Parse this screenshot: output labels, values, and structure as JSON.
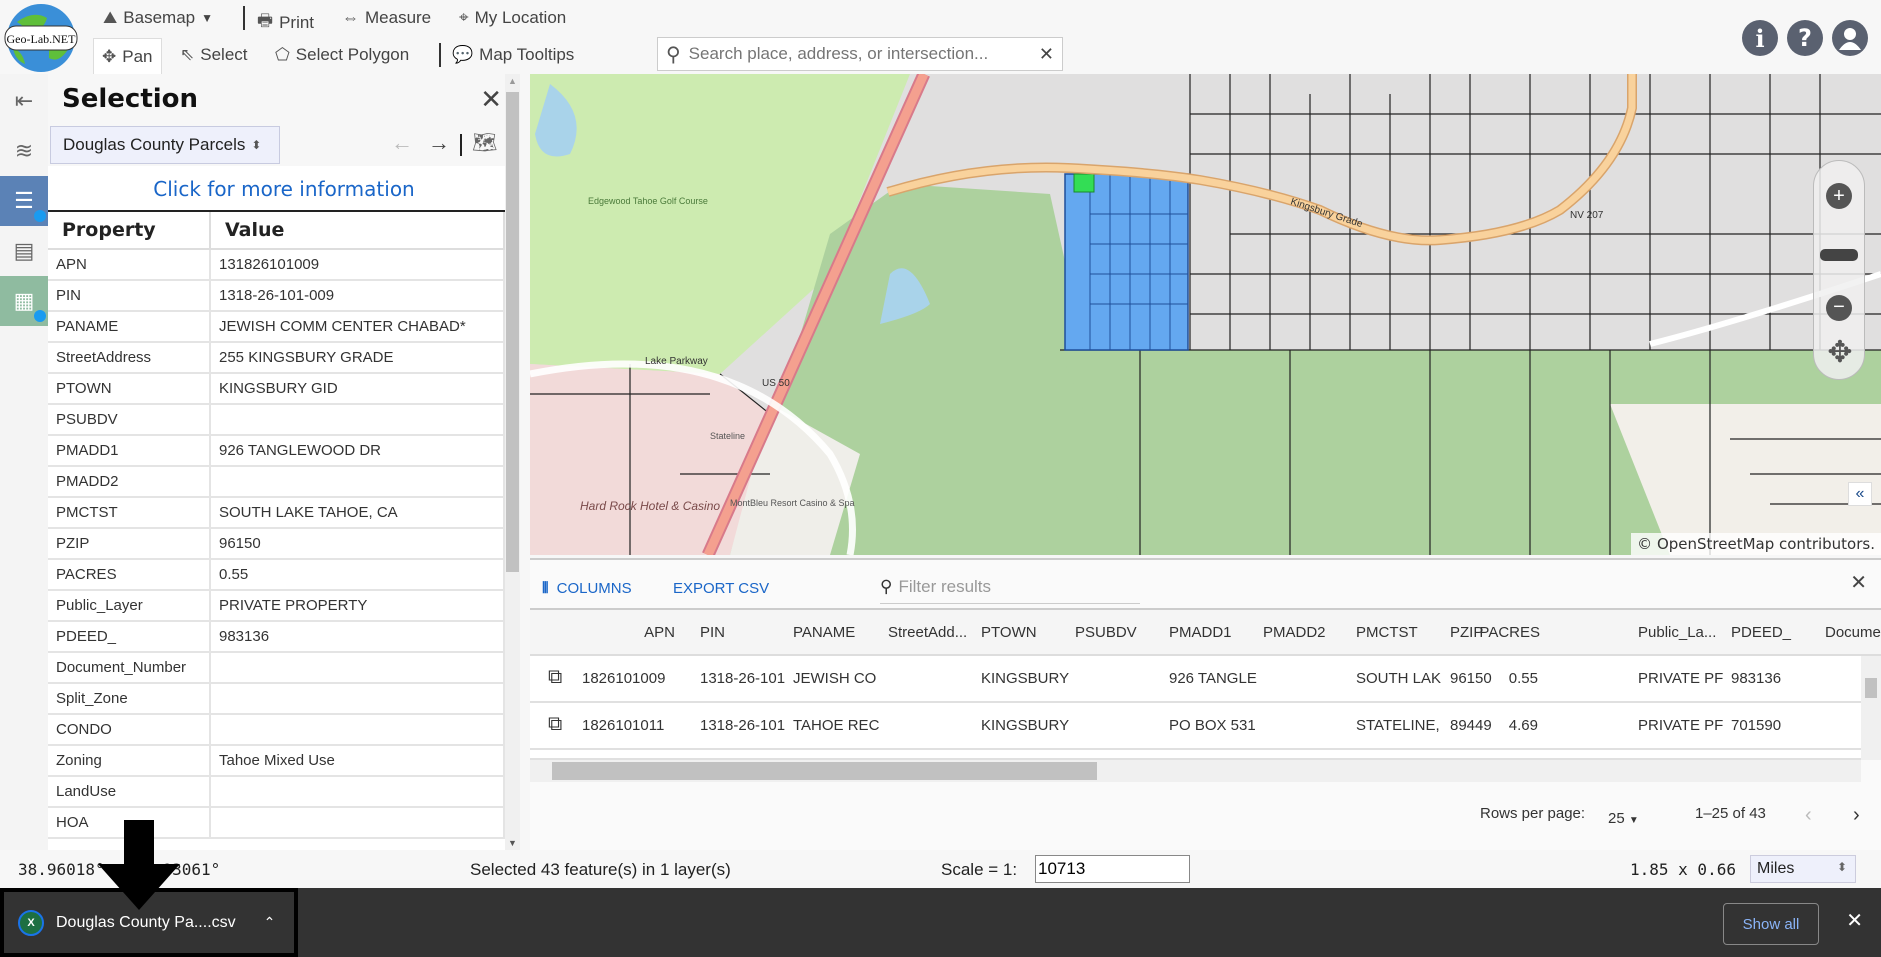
{
  "toolbar": {
    "logo": "Geo-Lab.NET",
    "basemap": "Basemap",
    "print": "Print",
    "measure": "Measure",
    "my_location": "My Location",
    "pan": "Pan",
    "select": "Select",
    "select_polygon": "Select Polygon",
    "map_tooltips": "Map Tooltips",
    "search_placeholder": "Search place, address, or intersection..."
  },
  "panel": {
    "title": "Selection",
    "layer": "Douglas County Parcels",
    "more_info": "Click for more information",
    "col_property": "Property",
    "col_value": "Value",
    "rows": [
      [
        "APN",
        "131826101009"
      ],
      [
        "PIN",
        "1318-26-101-009"
      ],
      [
        "PANAME",
        "JEWISH COMM CENTER CHABAD*"
      ],
      [
        "StreetAddress",
        "255 KINGSBURY GRADE"
      ],
      [
        "PTOWN",
        "KINGSBURY GID"
      ],
      [
        "PSUBDV",
        ""
      ],
      [
        "PMADD1",
        "926 TANGLEWOOD DR"
      ],
      [
        "PMADD2",
        ""
      ],
      [
        "PMCTST",
        "SOUTH LAKE TAHOE, CA"
      ],
      [
        "PZIP",
        "96150"
      ],
      [
        "PACRES",
        "0.55"
      ],
      [
        "Public_Layer",
        "PRIVATE PROPERTY"
      ],
      [
        "PDEED_",
        "983136"
      ],
      [
        "Document_Number",
        ""
      ],
      [
        "Split_Zone",
        ""
      ],
      [
        "CONDO",
        ""
      ],
      [
        "Zoning",
        "Tahoe Mixed Use"
      ],
      [
        "LandUse",
        ""
      ],
      [
        "HOA",
        ""
      ]
    ]
  },
  "map": {
    "attribution": "© OpenStreetMap contributors.",
    "labels": {
      "road1": "Kingsbury Grade",
      "hwy": "NV 207",
      "us50": "US 50",
      "lake": "Lake Parkway",
      "golf": "Edgewood Tahoe Golf Course",
      "hardrock": "Hard Rock Hotel & Casino",
      "montbleu": "MontBleu Resort Casino & Spa",
      "stateline": "Stateline"
    },
    "colors": {
      "selected": "#64a8f0",
      "highlight": "#33dd55",
      "forest": "#add19e",
      "golf": "#cdebb0"
    }
  },
  "results": {
    "columns_btn": "COLUMNS",
    "export_btn": "EXPORT CSV",
    "filter_placeholder": "Filter results",
    "headers": [
      "APN",
      "PIN",
      "PANAME",
      "StreetAdd...",
      "PTOWN",
      "PSUBDV",
      "PMADD1",
      "PMADD2",
      "PMCTST",
      "PZIP",
      "PACRES",
      "Public_La...",
      "PDEED_",
      "Docume"
    ],
    "rows": [
      [
        "1826101009",
        "1318-26-101",
        "JEWISH CO",
        "",
        "KINGSBURY",
        "",
        "926 TANGLE",
        "",
        "SOUTH LAK",
        "96150",
        "0.55",
        "PRIVATE PF",
        "983136",
        ""
      ],
      [
        "1826101011",
        "1318-26-101",
        "TAHOE REC",
        "",
        "KINGSBURY",
        "",
        "PO BOX 531",
        "",
        "STATELINE,",
        "89449",
        "4.69",
        "PRIVATE PF",
        "701590",
        ""
      ]
    ],
    "rows_per_page_label": "Rows per page:",
    "rows_per_page": "25",
    "range": "1–25 of 43"
  },
  "status": {
    "coords": "38.96018°  -119.93061°",
    "selected": "Selected 43 feature(s) in 1 layer(s)",
    "scale_label": "Scale = 1:",
    "scale": "10713",
    "extent": "1.85 x 0.66",
    "units": "Miles"
  },
  "download": {
    "file": "Douglas County Pa....csv",
    "show_all": "Show all"
  }
}
